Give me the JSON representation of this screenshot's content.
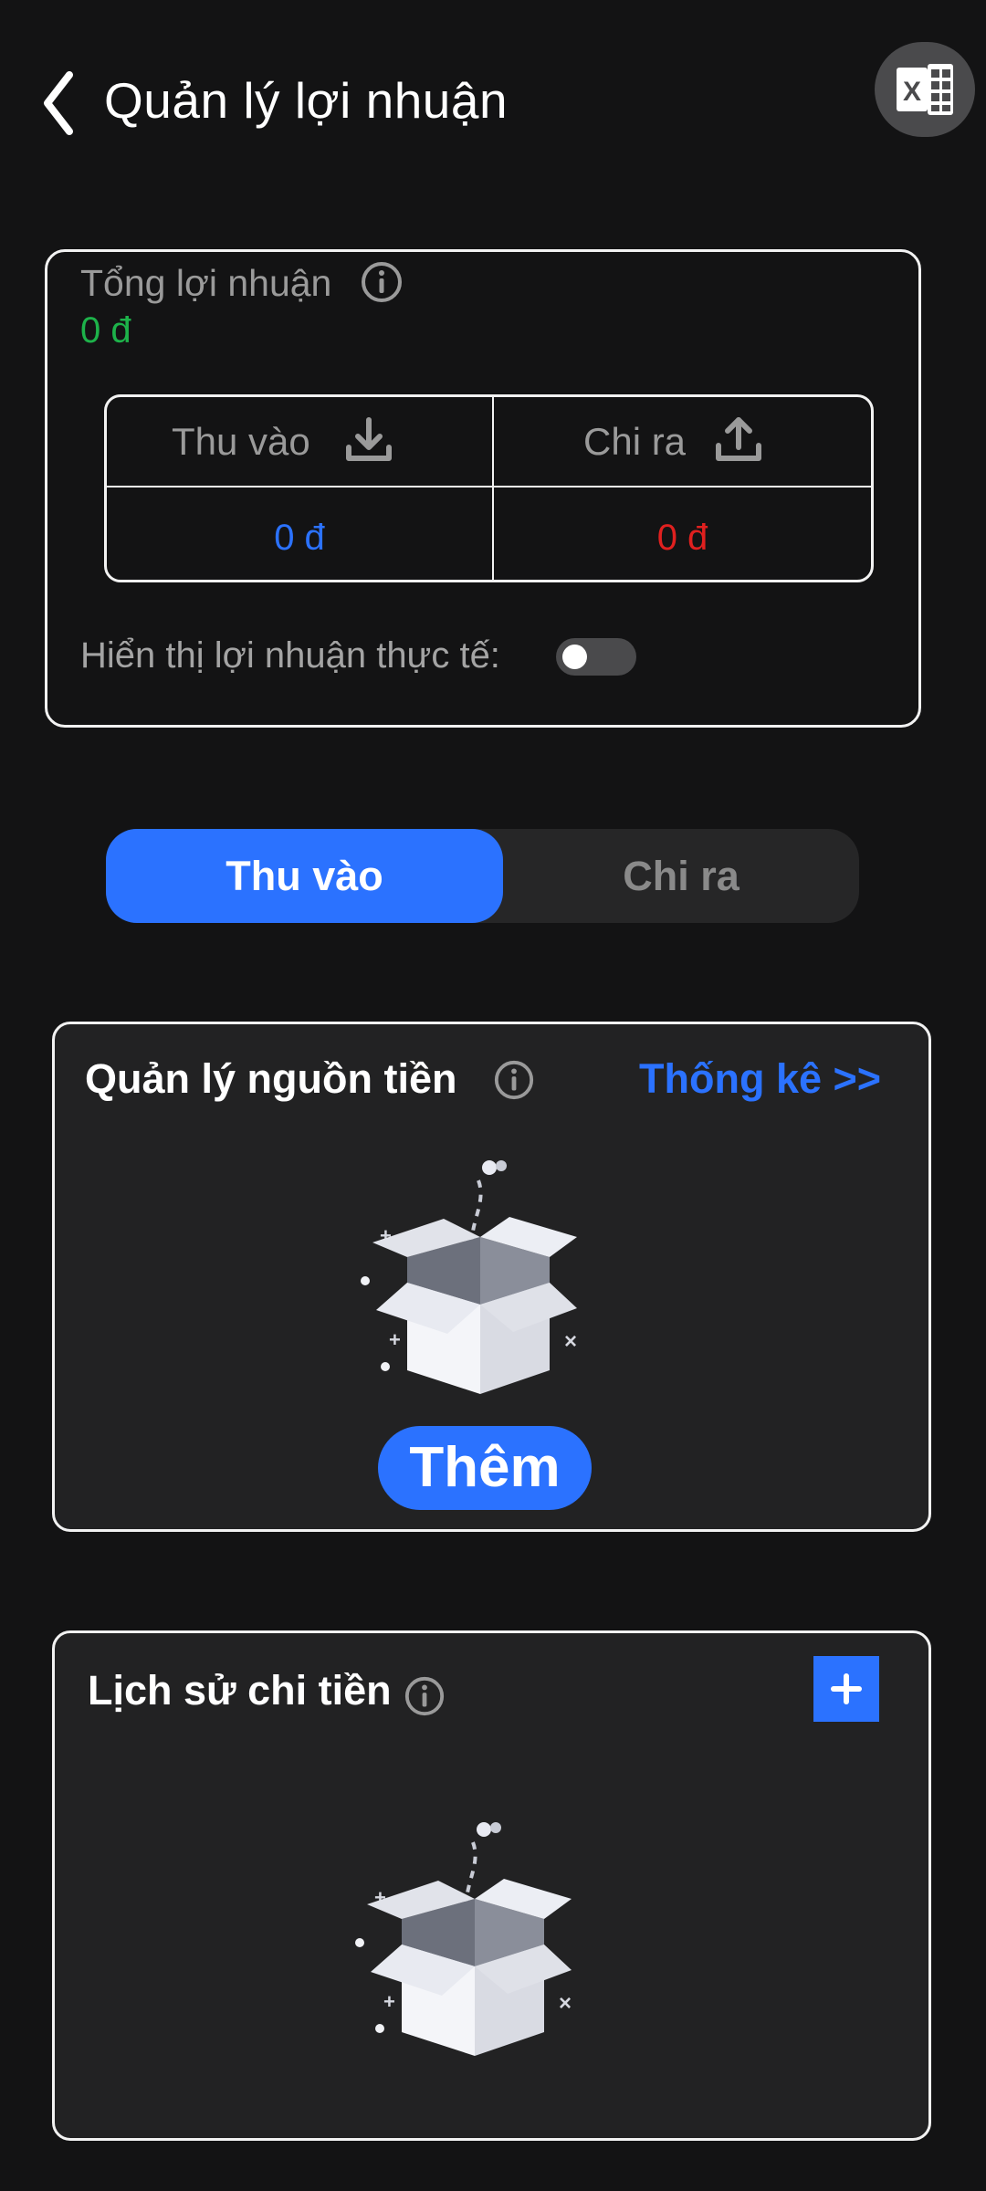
{
  "header": {
    "title": "Quản lý lợi nhuận",
    "back_icon": "chevron-left-icon",
    "export_icon": "excel-icon"
  },
  "summary": {
    "total_label": "Tổng lợi nhuận",
    "total_value": "0 đ",
    "income_label": "Thu vào",
    "income_value": "0 đ",
    "expense_label": "Chi ra",
    "expense_value": "0 đ",
    "actual_profit_label": "Hiển thị lợi nhuận thực tế:",
    "actual_profit_toggle_on": false
  },
  "segmented": {
    "options": [
      "Thu vào",
      "Chi ra"
    ],
    "selected_index": 0
  },
  "money_sources": {
    "title": "Quản lý nguồn tiền",
    "stats_link": "Thống kê >>",
    "add_button": "Thêm"
  },
  "spending_history": {
    "title": "Lịch sử chi tiền"
  },
  "colors": {
    "background": "#131314",
    "accent": "#2b72ff",
    "positive": "#1db24a",
    "negative": "#e0201f",
    "card": "#222223"
  }
}
